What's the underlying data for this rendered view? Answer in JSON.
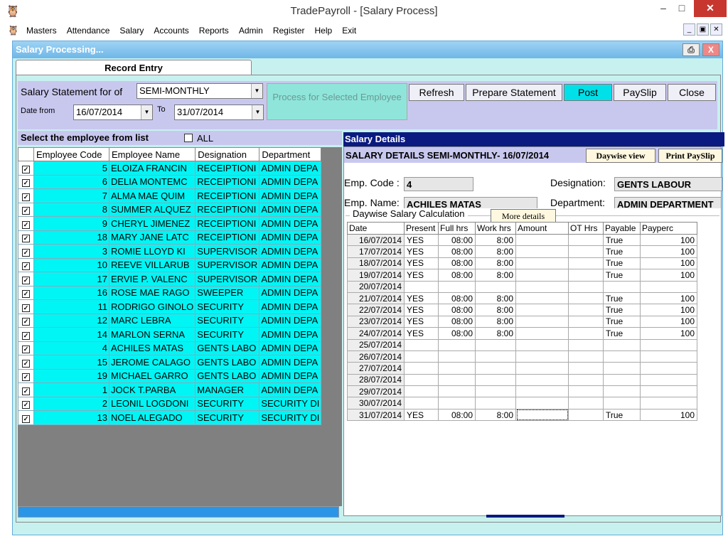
{
  "window": {
    "title": "TradePayroll - [Salary Process]",
    "app_icon": "owl-icon",
    "min": "–",
    "max": "□",
    "close": "✕"
  },
  "menu": {
    "items": [
      "Masters",
      "Attendance",
      "Salary",
      "Accounts",
      "Reports",
      "Admin",
      "Register",
      "Help",
      "Exit"
    ],
    "mdi_min": "_",
    "mdi_restore": "▣",
    "mdi_close": "✕"
  },
  "child": {
    "title": "Salary Processing...",
    "print": "⎙",
    "close": "X"
  },
  "tab": {
    "label": "Record Entry"
  },
  "criteria": {
    "statement_label": "Salary Statement for of",
    "statement_value": "SEMI-MONTHLY",
    "date_from_label": "Date from",
    "date_from": "16/07/2014",
    "to_label": "To",
    "date_to": "31/07/2014",
    "process_label": "Process for Selected Employee"
  },
  "actions": {
    "refresh": "Refresh",
    "prepare": "Prepare Statement",
    "post": "Post",
    "payslip": "PaySlip",
    "close": "Close"
  },
  "employees": {
    "select_label": "Select the employee from list",
    "all_label": "ALL",
    "columns": [
      "Employee Code",
      "Employee Name",
      "Designation",
      "Department"
    ],
    "rows": [
      {
        "code": "5",
        "name": "ELOIZA FRANCIN",
        "designation": "RECEIPTIONI",
        "department": "ADMIN DEPA"
      },
      {
        "code": "6",
        "name": "DELIA MONTEMC",
        "designation": "RECEIPTIONI",
        "department": "ADMIN DEPA"
      },
      {
        "code": "7",
        "name": "ALMA MAE QUIM",
        "designation": "RECEIPTIONI",
        "department": "ADMIN DEPA"
      },
      {
        "code": "8",
        "name": "SUMMER ALQUEZ",
        "designation": "RECEIPTIONI",
        "department": "ADMIN DEPA"
      },
      {
        "code": "9",
        "name": "CHERYL JIMENEZ",
        "designation": "RECEIPTIONI",
        "department": "ADMIN DEPA"
      },
      {
        "code": "18",
        "name": "MARY JANE LATC",
        "designation": "RECEIPTIONI",
        "department": "ADMIN DEPA"
      },
      {
        "code": "3",
        "name": "ROMIE LLOYD KI",
        "designation": "SUPERVISOR",
        "department": "ADMIN DEPA"
      },
      {
        "code": "10",
        "name": "REEVE VILLARUB",
        "designation": "SUPERVISOR",
        "department": "ADMIN DEPA"
      },
      {
        "code": "17",
        "name": "ERVIE P. VALENC",
        "designation": "SUPERVISOR",
        "department": "ADMIN DEPA"
      },
      {
        "code": "16",
        "name": "ROSE MAE RAGO",
        "designation": "SWEEPER",
        "department": "ADMIN DEPA"
      },
      {
        "code": "11",
        "name": "RODRIGO GINOLO",
        "designation": "SECURITY",
        "department": "ADMIN DEPA"
      },
      {
        "code": "12",
        "name": "MARC LEBRA",
        "designation": "SECURITY",
        "department": "ADMIN DEPA"
      },
      {
        "code": "14",
        "name": "MARLON SERNA",
        "designation": "SECURITY",
        "department": "ADMIN DEPA"
      },
      {
        "code": "4",
        "name": "ACHILES MATAS",
        "designation": "GENTS LABO",
        "department": "ADMIN DEPA"
      },
      {
        "code": "15",
        "name": "JEROME CALAGO",
        "designation": "GENTS LABO",
        "department": "ADMIN DEPA"
      },
      {
        "code": "19",
        "name": "MICHAEL GARRO",
        "designation": "GENTS LABO",
        "department": "ADMIN DEPA"
      },
      {
        "code": "1",
        "name": "JOCK T.PARBA",
        "designation": "MANAGER",
        "department": "ADMIN DEPA"
      },
      {
        "code": "2",
        "name": "LEONIL LOGDONI",
        "designation": "SECURITY",
        "department": "SECURITY DI"
      },
      {
        "code": "13",
        "name": "NOEL ALEGADO",
        "designation": "SECURITY",
        "department": "SECURITY DI"
      }
    ]
  },
  "salary": {
    "header": "Salary Details",
    "subheader": "SALARY DETAILS SEMI-MONTHLY- 16/07/2014",
    "daywise_btn": "Daywise view",
    "print_btn": "Print PaySlip",
    "emp_code_label": "Emp. Code :",
    "emp_code": "4",
    "emp_name_label": "Emp. Name:",
    "emp_name": "ACHILES MATAS",
    "designation_label": "Designation:",
    "designation": "GENTS LABOUR",
    "department_label": "Department:",
    "department": "ADMIN DEPARTMENT",
    "daywise_legend": "Daywise Salary Calculation",
    "more_btn": "More details",
    "columns": [
      "Date",
      "Present",
      "Full hrs",
      "Work hrs",
      "Amount",
      "OT Hrs",
      "Payable",
      "Payperc"
    ],
    "rows": [
      {
        "date": "16/07/2014",
        "present": "YES",
        "full": "08:00",
        "work": "8:00",
        "amount": "",
        "ot": "",
        "payable": "True",
        "payperc": "100"
      },
      {
        "date": "17/07/2014",
        "present": "YES",
        "full": "08:00",
        "work": "8:00",
        "amount": "",
        "ot": "",
        "payable": "True",
        "payperc": "100"
      },
      {
        "date": "18/07/2014",
        "present": "YES",
        "full": "08:00",
        "work": "8:00",
        "amount": "",
        "ot": "",
        "payable": "True",
        "payperc": "100"
      },
      {
        "date": "19/07/2014",
        "present": "YES",
        "full": "08:00",
        "work": "8:00",
        "amount": "",
        "ot": "",
        "payable": "True",
        "payperc": "100"
      },
      {
        "date": "20/07/2014",
        "present": "",
        "full": "",
        "work": "",
        "amount": "",
        "ot": "",
        "payable": "",
        "payperc": ""
      },
      {
        "date": "21/07/2014",
        "present": "YES",
        "full": "08:00",
        "work": "8:00",
        "amount": "",
        "ot": "",
        "payable": "True",
        "payperc": "100"
      },
      {
        "date": "22/07/2014",
        "present": "YES",
        "full": "08:00",
        "work": "8:00",
        "amount": "",
        "ot": "",
        "payable": "True",
        "payperc": "100"
      },
      {
        "date": "23/07/2014",
        "present": "YES",
        "full": "08:00",
        "work": "8:00",
        "amount": "",
        "ot": "",
        "payable": "True",
        "payperc": "100"
      },
      {
        "date": "24/07/2014",
        "present": "YES",
        "full": "08:00",
        "work": "8:00",
        "amount": "",
        "ot": "",
        "payable": "True",
        "payperc": "100"
      },
      {
        "date": "25/07/2014",
        "present": "",
        "full": "",
        "work": "",
        "amount": "",
        "ot": "",
        "payable": "",
        "payperc": ""
      },
      {
        "date": "26/07/2014",
        "present": "",
        "full": "",
        "work": "",
        "amount": "",
        "ot": "",
        "payable": "",
        "payperc": ""
      },
      {
        "date": "27/07/2014",
        "present": "",
        "full": "",
        "work": "",
        "amount": "",
        "ot": "",
        "payable": "",
        "payperc": ""
      },
      {
        "date": "28/07/2014",
        "present": "",
        "full": "",
        "work": "",
        "amount": "",
        "ot": "",
        "payable": "",
        "payperc": ""
      },
      {
        "date": "29/07/2014",
        "present": "",
        "full": "",
        "work": "",
        "amount": "",
        "ot": "",
        "payable": "",
        "payperc": ""
      },
      {
        "date": "30/07/2014",
        "present": "",
        "full": "",
        "work": "",
        "amount": "",
        "ot": "",
        "payable": "",
        "payperc": ""
      },
      {
        "date": "31/07/2014",
        "present": "YES",
        "full": "08:00",
        "work": "8:00",
        "amount": "",
        "ot": "",
        "payable": "True",
        "payperc": "100"
      }
    ]
  },
  "colors": {
    "accent_cyan": "#00f5f5",
    "dark_blue": "#0a1a80",
    "lavender": "#c8c8ef"
  }
}
